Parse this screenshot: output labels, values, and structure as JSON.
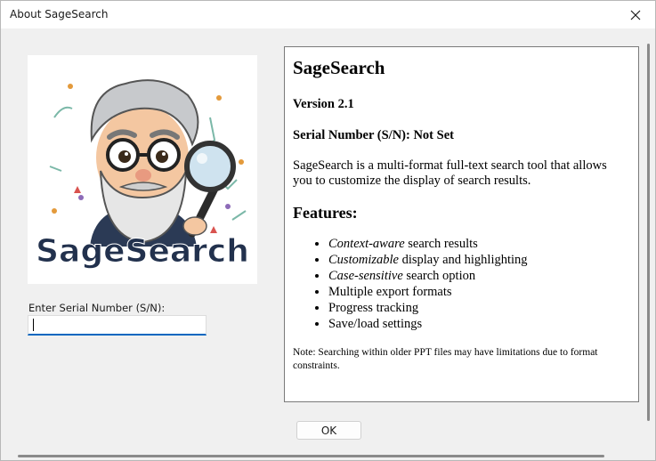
{
  "window": {
    "title": "About SageSearch",
    "close_icon": "close-icon"
  },
  "logo": {
    "text": "SageSearch",
    "icon": "sage-with-magnifier-logo"
  },
  "serial": {
    "label": "Enter Serial Number (S/N):",
    "value": ""
  },
  "info": {
    "title": "SageSearch",
    "version": "Version 2.1",
    "serial_status": "Serial Number (S/N): Not Set",
    "description": "SageSearch is a multi-format full-text search tool that allows you to customize the display of search results.",
    "features_heading": "Features:",
    "features": [
      {
        "em": "Context-aware",
        "rest": " search results"
      },
      {
        "em": "Customizable",
        "rest": " display and highlighting"
      },
      {
        "em": "Case-sensitive",
        "rest": " search option"
      },
      {
        "em": "",
        "rest": "Multiple export formats"
      },
      {
        "em": "",
        "rest": "Progress tracking"
      },
      {
        "em": "",
        "rest": "Save/load settings"
      }
    ],
    "note": "Note: Searching within older PPT files may have limitations due to format constraints."
  },
  "buttons": {
    "ok_label": "OK"
  }
}
